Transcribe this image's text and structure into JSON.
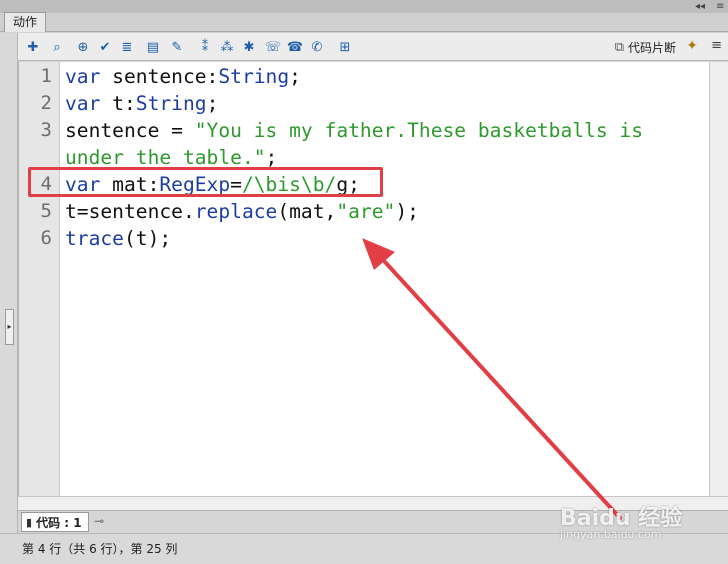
{
  "panel": {
    "tab_label": "动作",
    "controls": [
      "◂◂",
      "≡"
    ]
  },
  "toolbar": {
    "icons": [
      {
        "name": "add-action-icon",
        "glyph": "✚"
      },
      {
        "name": "find-icon",
        "glyph": "⌕"
      },
      {
        "name": "target-path-icon",
        "glyph": "⊕"
      },
      {
        "name": "check-syntax-icon",
        "glyph": "✔"
      },
      {
        "name": "auto-format-icon",
        "glyph": "≣"
      },
      {
        "name": "code-hint-icon",
        "glyph": "▤"
      },
      {
        "name": "debug-options-icon",
        "glyph": "✎"
      },
      {
        "name": "collapse-between-braces-icon",
        "glyph": "⁑"
      },
      {
        "name": "collapse-selection-icon",
        "glyph": "⁂"
      },
      {
        "name": "expand-all-icon",
        "glyph": "✱"
      },
      {
        "name": "apply-block-comment-icon",
        "glyph": "☏"
      },
      {
        "name": "apply-line-comment-icon",
        "glyph": "☎"
      },
      {
        "name": "remove-comment-icon",
        "glyph": "✆"
      },
      {
        "name": "toggle-script-assist-icon",
        "glyph": "⊞"
      }
    ],
    "snippets_label": "代码片断"
  },
  "editor": {
    "line_numbers": [
      "1",
      "2",
      "3",
      "",
      "4",
      "5",
      "6"
    ],
    "lines": [
      {
        "tokens": [
          {
            "t": "var",
            "c": "kw"
          },
          {
            "t": " sentence:",
            "c": ""
          },
          {
            "t": "String",
            "c": "kw"
          },
          {
            "t": ";",
            "c": ""
          }
        ]
      },
      {
        "tokens": [
          {
            "t": "var",
            "c": "kw"
          },
          {
            "t": " t:",
            "c": ""
          },
          {
            "t": "String",
            "c": "kw"
          },
          {
            "t": ";",
            "c": ""
          }
        ]
      },
      {
        "tokens": [
          {
            "t": "sentence = ",
            "c": ""
          },
          {
            "t": "\"You is my father.These basketballs is",
            "c": "str"
          }
        ]
      },
      {
        "tokens": [
          {
            "t": "under the table.\"",
            "c": "str"
          },
          {
            "t": ";",
            "c": ""
          }
        ]
      },
      {
        "tokens": [
          {
            "t": "var",
            "c": "kw"
          },
          {
            "t": " mat:",
            "c": ""
          },
          {
            "t": "RegExp",
            "c": "kw"
          },
          {
            "t": "=",
            "c": ""
          },
          {
            "t": "/\\bis\\b/",
            "c": "str"
          },
          {
            "t": "g;",
            "c": ""
          }
        ]
      },
      {
        "tokens": [
          {
            "t": "t=sentence.",
            "c": ""
          },
          {
            "t": "replace",
            "c": "fn"
          },
          {
            "t": "(mat,",
            "c": ""
          },
          {
            "t": "\"are\"",
            "c": "str"
          },
          {
            "t": ");",
            "c": ""
          }
        ]
      },
      {
        "tokens": [
          {
            "t": "trace",
            "c": "fn"
          },
          {
            "t": "(t);",
            "c": ""
          }
        ]
      }
    ]
  },
  "script_tab": {
    "label": "代码 : 1"
  },
  "status": {
    "text": "第 4 行（共 6 行），第 25 列"
  },
  "watermark": {
    "brand": "Baidu 经验",
    "url": "jingyan.baidu.com"
  },
  "colors": {
    "annotation": "#e13e45",
    "keyword": "#1d3ea0",
    "string": "#2e9a2e"
  }
}
